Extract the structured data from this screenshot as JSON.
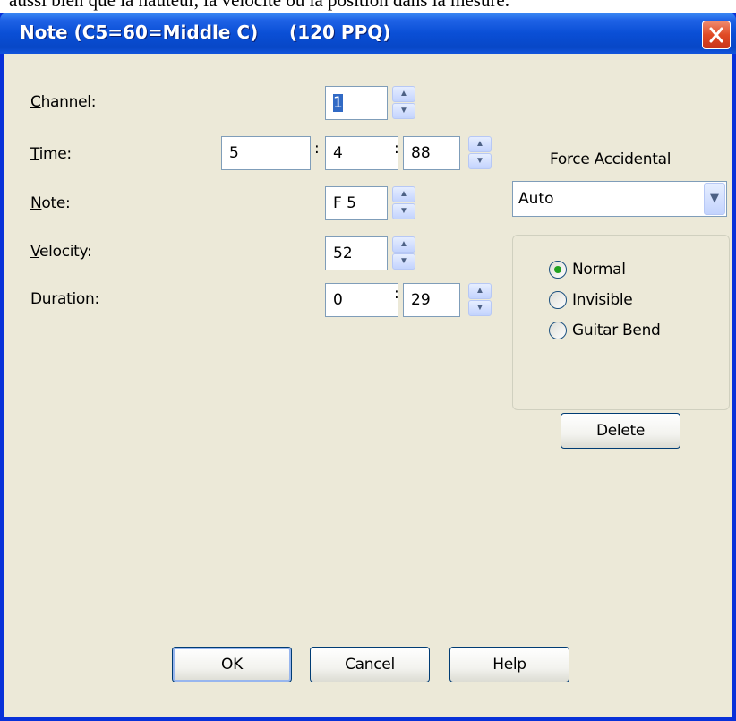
{
  "page_caption": "aussi bien que la hauteur, la vélocité ou la position dans la mesure.",
  "window": {
    "title": "Note (C5=60=Middle C)     (120 PPQ)"
  },
  "labels": {
    "channel": {
      "first": "C",
      "rest": "hannel:"
    },
    "time": {
      "first": "T",
      "rest": "ime:"
    },
    "note": {
      "first": "N",
      "rest": "ote:"
    },
    "velocity": {
      "first": "V",
      "rest": "elocity:"
    },
    "duration": {
      "first": "D",
      "rest": "uration:"
    }
  },
  "fields": {
    "channel": "1",
    "time_bar": "5",
    "time_beat": "4",
    "time_tick": "88",
    "note": "F 5",
    "velocity": "52",
    "duration_beats": "0",
    "duration_ticks": "29"
  },
  "separator": ":",
  "force_accidental": {
    "label": "Force Accidental",
    "selected": "Auto"
  },
  "radios": [
    {
      "label": "Normal",
      "checked": true
    },
    {
      "label": "Invisible",
      "checked": false
    },
    {
      "label": "Guitar Bend",
      "checked": false
    }
  ],
  "buttons": {
    "delete": "Delete",
    "ok": "OK",
    "cancel": "Cancel",
    "help": "Help"
  },
  "icons": {
    "close": "close-icon",
    "spin_up": "arrow-up-icon",
    "spin_down": "arrow-down-icon",
    "dropdown": "chevron-down-icon"
  },
  "colors": {
    "titlebar": "#0a4fd6",
    "dialog_bg": "#ece9d8",
    "close_button": "#e04a24",
    "radio_dot": "#21a121"
  }
}
